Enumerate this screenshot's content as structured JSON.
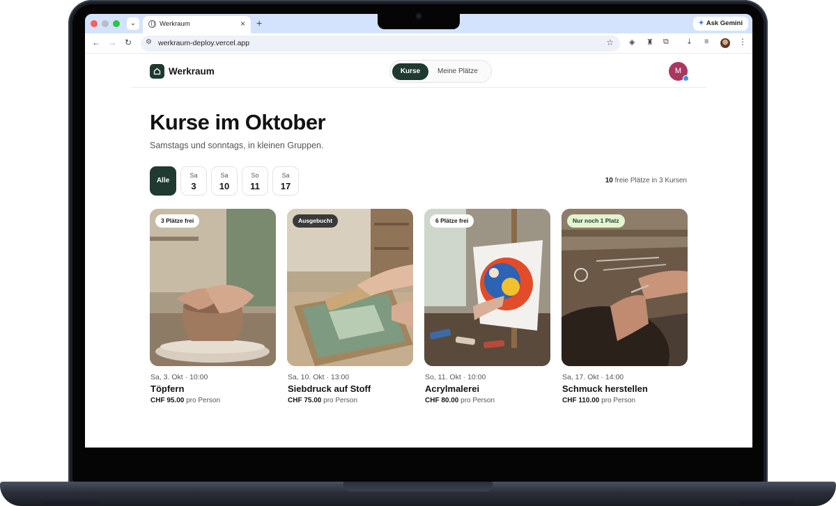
{
  "browser": {
    "tab_title": "Werkraum",
    "tab_close": "×",
    "tab_new": "+",
    "ask_gemini": "Ask Gemini",
    "url": "werkraum-deploy.vercel.app",
    "icons": [
      "back-icon",
      "forward-icon",
      "reload-icon",
      "tune-icon",
      "star-icon",
      "extension-icon",
      "download-icon",
      "playlist-icon",
      "profile-icon",
      "kebab-menu-icon"
    ]
  },
  "header": {
    "brand": "Werkraum",
    "nav": {
      "active": "Kurse",
      "other": "Meine Plätze"
    },
    "avatar_initial": "M"
  },
  "main": {
    "title": "Kurse im Oktober",
    "subtitle": "Samstags und sonntags, in kleinen Gruppen.",
    "filters": {
      "all": "Alle",
      "days": [
        {
          "weekday": "Sa",
          "day": "3"
        },
        {
          "weekday": "Sa",
          "day": "10"
        },
        {
          "weekday": "So",
          "day": "11"
        },
        {
          "weekday": "Sa",
          "day": "17"
        }
      ]
    },
    "summary": {
      "count": "10",
      "text": "freie Plätze in 3 Kursen"
    },
    "cards": [
      {
        "badge": "3 Plätze frei",
        "date": "Sa, 3. Okt · 10:00",
        "title": "Töpfern",
        "price": "CHF 95.00",
        "unit": "pro Person"
      },
      {
        "badge": "Ausgebucht",
        "date": "Sa, 10. Okt · 13:00",
        "title": "Siebdruck auf Stoff",
        "price": "CHF 75.00",
        "unit": "pro Person"
      },
      {
        "badge": "6 Plätze frei",
        "date": "So, 11. Okt · 10:00",
        "title": "Acrylmalerei",
        "price": "CHF 80.00",
        "unit": "pro Person"
      },
      {
        "badge": "Nur noch 1 Platz",
        "date": "Sa, 17. Okt · 14:00",
        "title": "Schmuck herstellen",
        "price": "CHF 110.00",
        "unit": "pro Person"
      }
    ]
  },
  "colors": {
    "brand": "#1f3a30",
    "avatar": "#a8385f",
    "badge_green": "#e3f4cf",
    "tab_bar": "#d3e3fd"
  }
}
